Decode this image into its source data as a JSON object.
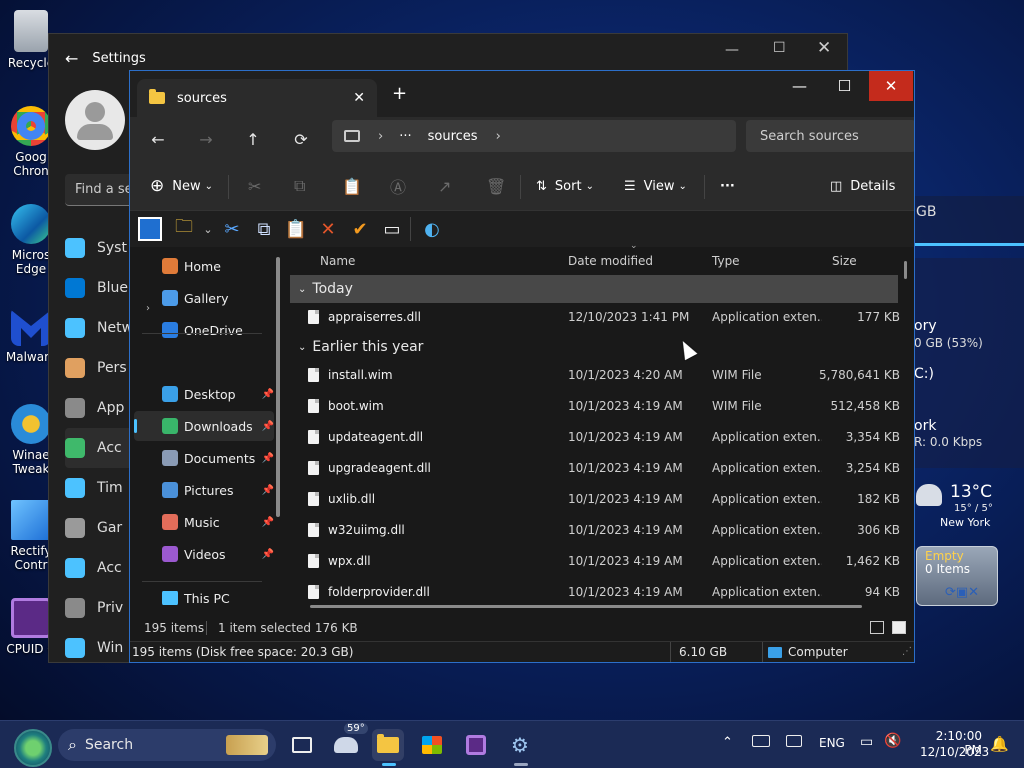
{
  "desktop": {
    "icons": [
      {
        "label": "Recycle",
        "icon": "recycle-bin-icon"
      },
      {
        "label": "Goog Chron",
        "icon": "chrome-icon"
      },
      {
        "label": "Micros Edge",
        "icon": "edge-icon"
      },
      {
        "label": "Malware",
        "icon": "malwarebytes-icon"
      },
      {
        "label": "Winae Tweak",
        "icon": "winaero-tweaker-icon"
      },
      {
        "label": "Rectify Contr",
        "icon": "rectify11-icon"
      },
      {
        "label": "CPUID C",
        "icon": "cpuid-icon"
      }
    ]
  },
  "gadgets": {
    "disk_label": "GB",
    "memory_title": "ory",
    "memory_value": "0 GB (53%)",
    "drive_label": "C:)",
    "network_title": "ork",
    "network_value": "R: 0.0 Kbps",
    "weather_temp": "13°C",
    "weather_range": "15° / 5°",
    "weather_city": "New York",
    "recycle_status": "Empty",
    "recycle_items": "0 Items"
  },
  "settings": {
    "title": "Settings",
    "search_placeholder": "Find a se",
    "nav": [
      {
        "label": "Syst",
        "icon": "system-icon",
        "color": "#4cc2ff"
      },
      {
        "label": "Blue",
        "icon": "bluetooth-icon",
        "color": "#0078d4"
      },
      {
        "label": "Netw",
        "icon": "network-icon",
        "color": "#4cc2ff"
      },
      {
        "label": "Pers",
        "icon": "personalization-icon",
        "color": "#e0a060"
      },
      {
        "label": "App",
        "icon": "apps-icon",
        "color": "#8a8a8a"
      },
      {
        "label": "Acc",
        "icon": "accounts-icon",
        "color": "#3fb96b"
      },
      {
        "label": "Tim",
        "icon": "time-language-icon",
        "color": "#4cc2ff"
      },
      {
        "label": "Gar",
        "icon": "gaming-icon",
        "color": "#9a9a9a"
      },
      {
        "label": "Acc",
        "icon": "accessibility-icon",
        "color": "#4cc2ff"
      },
      {
        "label": "Priv",
        "icon": "privacy-icon",
        "color": "#8a8a8a"
      },
      {
        "label": "Win",
        "icon": "windows-update-icon",
        "color": "#4cc2ff"
      }
    ]
  },
  "explorer": {
    "tab_title": "sources",
    "address": {
      "ellipsis": "···",
      "folder": "sources"
    },
    "search_placeholder": "Search sources",
    "commands": {
      "new": "New",
      "sort": "Sort",
      "view": "View",
      "more": "···",
      "details": "Details"
    },
    "nav_items": [
      {
        "label": "Home",
        "icon": "home-icon",
        "color": "#e07b39",
        "pinned": false
      },
      {
        "label": "Gallery",
        "icon": "gallery-icon",
        "color": "#4c9be8",
        "pinned": false
      },
      {
        "label": "OneDrive",
        "icon": "onedrive-icon",
        "color": "#2a7de1",
        "pinned": false
      },
      {
        "label": "Desktop",
        "icon": "desktop-icon",
        "color": "#3aa0e8",
        "pinned": true
      },
      {
        "label": "Downloads",
        "icon": "downloads-icon",
        "color": "#39b56a",
        "pinned": true
      },
      {
        "label": "Documents",
        "icon": "documents-icon",
        "color": "#8a9bb5",
        "pinned": true
      },
      {
        "label": "Pictures",
        "icon": "pictures-icon",
        "color": "#4a90d9",
        "pinned": true
      },
      {
        "label": "Music",
        "icon": "music-icon",
        "color": "#e26d5a",
        "pinned": true
      },
      {
        "label": "Videos",
        "icon": "videos-icon",
        "color": "#9b59d0",
        "pinned": true
      },
      {
        "label": "This PC",
        "icon": "this-pc-icon",
        "color": "#4cc2ff",
        "pinned": false
      }
    ],
    "columns": {
      "name": "Name",
      "date": "Date modified",
      "type": "Type",
      "size": "Size"
    },
    "groups": {
      "today": "Today",
      "earlier": "Earlier this year"
    },
    "files_today": [
      {
        "name": "appraiserres.dll",
        "date": "12/10/2023 1:41 PM",
        "type": "Application exten...",
        "size": "177 KB"
      }
    ],
    "files_earlier": [
      {
        "name": "install.wim",
        "date": "10/1/2023 4:20 AM",
        "type": "WIM File",
        "size": "5,780,641 KB"
      },
      {
        "name": "boot.wim",
        "date": "10/1/2023 4:19 AM",
        "type": "WIM File",
        "size": "512,458 KB"
      },
      {
        "name": "updateagent.dll",
        "date": "10/1/2023 4:19 AM",
        "type": "Application exten...",
        "size": "3,354 KB"
      },
      {
        "name": "upgradeagent.dll",
        "date": "10/1/2023 4:19 AM",
        "type": "Application exten...",
        "size": "3,254 KB"
      },
      {
        "name": "uxlib.dll",
        "date": "10/1/2023 4:19 AM",
        "type": "Application exten...",
        "size": "182 KB"
      },
      {
        "name": "w32uiimg.dll",
        "date": "10/1/2023 4:19 AM",
        "type": "Application exten...",
        "size": "306 KB"
      },
      {
        "name": "wpx.dll",
        "date": "10/1/2023 4:19 AM",
        "type": "Application exten...",
        "size": "1,462 KB"
      },
      {
        "name": "folderprovider.dll",
        "date": "10/1/2023 4:19 AM",
        "type": "Application exten...",
        "size": "94 KB"
      }
    ],
    "status": {
      "count": "195 items",
      "selected": "1 item selected  176 KB"
    },
    "bottom": {
      "info": "195 items (Disk free space: 20.3 GB)",
      "size": "6.10 GB",
      "location": "Computer"
    }
  },
  "taskbar": {
    "search_label": "Search",
    "weather_badge": "59°",
    "language": "ENG",
    "time": "2:10:00 PM",
    "date": "12/10/2023"
  },
  "colors": {
    "accent": "#4cc2ff",
    "close_red": "#c42b1c",
    "taskbar": "#1b2a55"
  }
}
